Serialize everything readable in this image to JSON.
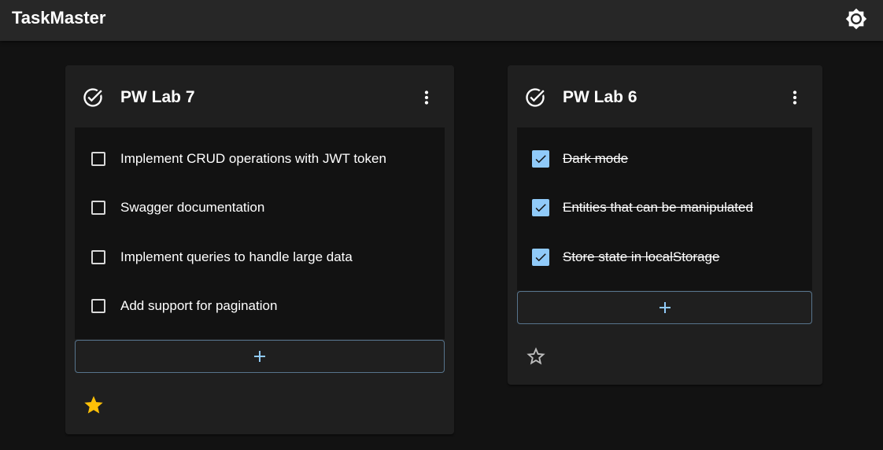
{
  "app": {
    "title": "TaskMaster",
    "theme_toggle_icon": "brightness-icon"
  },
  "colors": {
    "background": "#121212",
    "appbar": "#272727",
    "card": "#1f1f1f",
    "accent": "#90caf9",
    "star_active": "#ffc107",
    "star_inactive": "#bdbdbd"
  },
  "cards": [
    {
      "title": "PW Lab 7",
      "header_icon": "check-circle-icon",
      "menu_icon": "more-vert-icon",
      "starred": true,
      "tasks": [
        {
          "text": "Implement CRUD operations with JWT token",
          "done": false
        },
        {
          "text": "Swagger documentation",
          "done": false
        },
        {
          "text": "Implement queries to handle large data",
          "done": false
        },
        {
          "text": "Add support for pagination",
          "done": false
        }
      ],
      "add_icon": "plus-icon"
    },
    {
      "title": "PW Lab 6",
      "header_icon": "check-circle-icon",
      "menu_icon": "more-vert-icon",
      "starred": false,
      "tasks": [
        {
          "text": "Dark mode",
          "done": true
        },
        {
          "text": "Entities that can be manipulated",
          "done": true
        },
        {
          "text": "Store state in localStorage",
          "done": true
        }
      ],
      "add_icon": "plus-icon"
    }
  ]
}
